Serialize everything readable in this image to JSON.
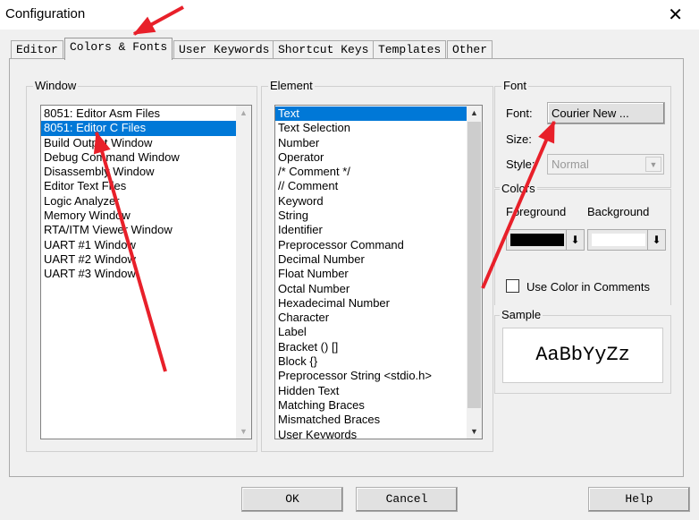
{
  "window": {
    "title": "Configuration",
    "close": "✕"
  },
  "tabs": [
    {
      "label": "Editor"
    },
    {
      "label": "Colors & Fonts",
      "active": true
    },
    {
      "label": "User Keywords"
    },
    {
      "label": "Shortcut Keys"
    },
    {
      "label": "Templates"
    },
    {
      "label": "Other"
    }
  ],
  "window_group": {
    "label": "Window",
    "items": [
      "8051: Editor Asm Files",
      "8051: Editor C Files",
      "Build Output Window",
      "Debug Command Window",
      "Disassembly Window",
      "Editor Text Files",
      "Logic Analyzer",
      "Memory Window",
      "RTA/ITM Viewer Window",
      "UART #1 Window",
      "UART #2 Window",
      "UART #3 Window"
    ],
    "selected": "8051: Editor C Files"
  },
  "element_group": {
    "label": "Element",
    "items": [
      "Text",
      "Text Selection",
      "Number",
      "Operator",
      "/* Comment */",
      "// Comment",
      "Keyword",
      "String",
      "Identifier",
      "Preprocessor Command",
      "Decimal Number",
      "Float Number",
      "Octal Number",
      "Hexadecimal Number",
      "Character",
      "Label",
      "Bracket () []",
      "Block {}",
      "Preprocessor String <stdio.h>",
      "Hidden Text",
      "Matching Braces",
      "Mismatched Braces",
      "User Keywords"
    ],
    "selected": "Text"
  },
  "font_group": {
    "label": "Font",
    "font_label": "Font:",
    "font_button": "Courier New ...",
    "size_label": "Size:",
    "style_label": "Style:",
    "style_value": "Normal"
  },
  "colors_group": {
    "label": "Colors",
    "foreground_label": "Foreground",
    "background_label": "Background",
    "foreground_color": "#000000",
    "background_color": "#ffffff",
    "use_color_in_comments": "Use Color in Comments",
    "use_color_checked": false
  },
  "sample_group": {
    "label": "Sample",
    "text": "AaBbYyZz"
  },
  "buttons": {
    "ok": "OK",
    "cancel": "Cancel",
    "help": "Help"
  },
  "annotation_color": "#e8202a"
}
